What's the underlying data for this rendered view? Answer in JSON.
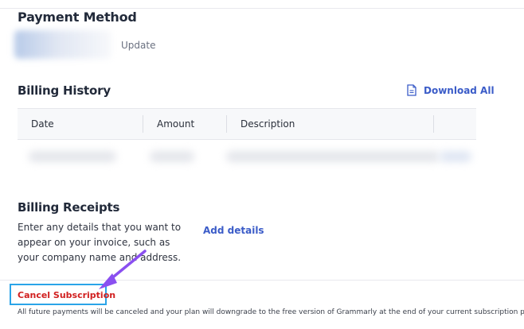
{
  "payment_method": {
    "title": "Payment Method",
    "update_label": "Update"
  },
  "billing_history": {
    "title": "Billing History",
    "download_all_label": "Download All",
    "columns": [
      "Date",
      "Amount",
      "Description",
      ""
    ]
  },
  "billing_receipts": {
    "title": "Billing Receipts",
    "description": "Enter any details that you want to appear on your invoice, such as your company name and address.",
    "add_details_label": "Add details"
  },
  "cancel": {
    "label": "Cancel Subscription",
    "note": "All future payments will be canceled and your plan will downgrade to the free version of Grammarly at the end of your current subscription period."
  },
  "colors": {
    "accent": "#3b5cc8",
    "danger": "#d11f1f",
    "highlight_box": "#2aa4e8",
    "annotation_arrow": "#8a4ff0"
  }
}
